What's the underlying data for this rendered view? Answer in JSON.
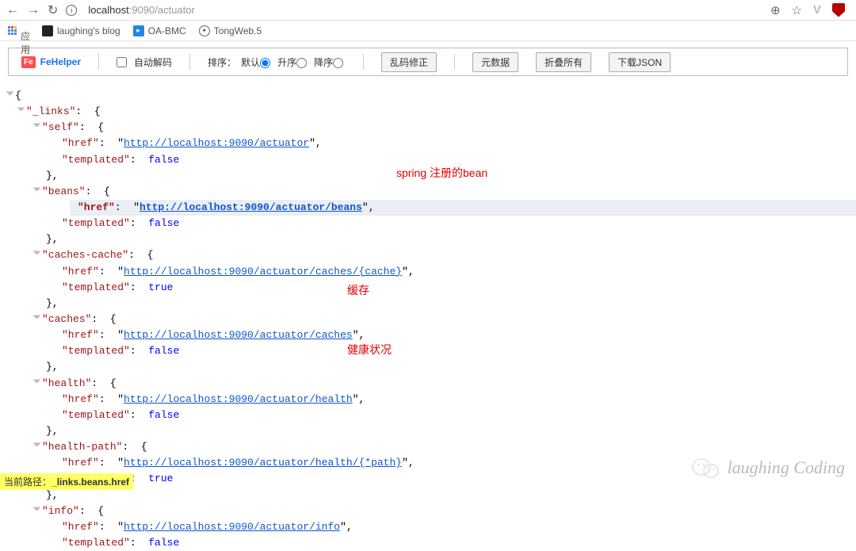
{
  "browser": {
    "url_host": "localhost",
    "url_rest": ":9090/actuator",
    "bookmarks_apps": "应用",
    "bm_blog": "laughing's blog",
    "bm_oa": "OA-BMC",
    "bm_tong": "TongWeb.5"
  },
  "fehelper": {
    "brand": "FeHelper",
    "brand_badge": "Fe",
    "auto_decode": "自动解码",
    "sort_label": "排序：",
    "sort_default": "默认",
    "sort_asc": "升序",
    "sort_desc": "降序",
    "btn_fix": "乱码修正",
    "btn_meta": "元数据",
    "btn_collapse": "折叠所有",
    "btn_download": "下载JSON"
  },
  "annotations": {
    "beans": "spring 注册的bean",
    "caches": "缓存",
    "health": "健康状况"
  },
  "path_badge": {
    "label": "当前路径：",
    "path": "_links.beans.href"
  },
  "json": {
    "root_open": "{",
    "links_key": "\"_links\"",
    "colon_brace": ":  {",
    "close_brace_comma": "},",
    "self": {
      "key": "\"self\"",
      "open": ":  {",
      "href_key": "\"href\"",
      "href_val": "http://localhost:9090/actuator",
      "tpl_key": "\"templated\"",
      "tpl_val": "false"
    },
    "beans": {
      "key": "\"beans\"",
      "open": ":  {",
      "href_key": "\"href\"",
      "href_val": "http://localhost:9090/actuator/beans",
      "tpl_key": "\"templated\"",
      "tpl_val": "false"
    },
    "caches_cache": {
      "key": "\"caches-cache\"",
      "open": ":  {",
      "href_key": "\"href\"",
      "href_val": "http://localhost:9090/actuator/caches/{cache}",
      "tpl_key": "\"templated\"",
      "tpl_val": "true"
    },
    "caches": {
      "key": "\"caches\"",
      "open": ":  {",
      "href_key": "\"href\"",
      "href_val": "http://localhost:9090/actuator/caches",
      "tpl_key": "\"templated\"",
      "tpl_val": "false"
    },
    "health": {
      "key": "\"health\"",
      "open": ":  {",
      "href_key": "\"href\"",
      "href_val": "http://localhost:9090/actuator/health",
      "tpl_key": "\"templated\"",
      "tpl_val": "false"
    },
    "health_path": {
      "key": "\"health-path\"",
      "open": ":  {",
      "href_key": "\"href\"",
      "href_val": "http://localhost:9090/actuator/health/{*path}",
      "tpl_key": "\"templated\"",
      "tpl_val": "true"
    },
    "info": {
      "key": "\"info\"",
      "open": ":  {",
      "href_key": "\"href\"",
      "href_val": "http://localhost:9090/actuator/info",
      "tpl_key": "\"templated\"",
      "tpl_val": "false"
    }
  },
  "watermark": "laughing Coding"
}
